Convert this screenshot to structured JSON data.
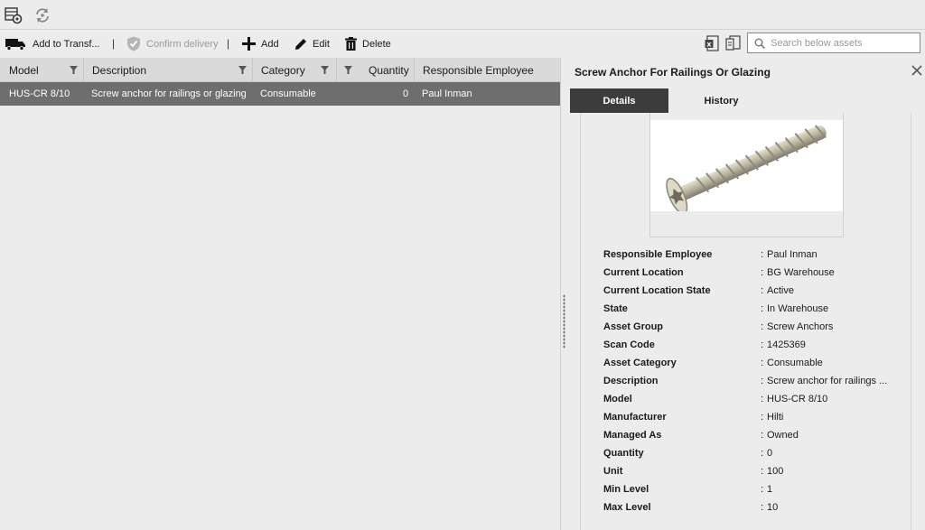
{
  "toolbar": {
    "add_to_transfer": "Add to Transf...",
    "confirm_delivery": "Confirm delivery",
    "separator": "|",
    "add": "Add",
    "edit": "Edit",
    "delete": "Delete"
  },
  "search": {
    "placeholder": "Search below assets"
  },
  "grid": {
    "columns": [
      "Model",
      "Description",
      "Category",
      "Quantity",
      "Responsible Employee"
    ],
    "rows": [
      {
        "model": "HUS-CR 8/10",
        "description": "Screw anchor for railings or glazing",
        "category": "Consumable",
        "quantity": "0",
        "responsible_employee": "Paul Inman"
      }
    ]
  },
  "panel": {
    "title": "Screw Anchor For Railings Or Glazing",
    "tabs": [
      "Details",
      "History"
    ],
    "colon": ":",
    "properties": [
      {
        "key": "Responsible Employee",
        "value": "Paul Inman"
      },
      {
        "key": "Current Location",
        "value": "BG Warehouse"
      },
      {
        "key": "Current Location State",
        "value": "Active"
      },
      {
        "key": "State",
        "value": "In Warehouse"
      },
      {
        "key": "Asset Group",
        "value": "Screw Anchors"
      },
      {
        "key": "Scan Code",
        "value": "1425369"
      },
      {
        "key": "Asset Category",
        "value": "Consumable"
      },
      {
        "key": "Description",
        "value": "Screw anchor for railings ..."
      },
      {
        "key": "Model",
        "value": "HUS-CR 8/10"
      },
      {
        "key": "Manufacturer",
        "value": "Hilti"
      },
      {
        "key": "Managed As",
        "value": "Owned"
      },
      {
        "key": "Quantity",
        "value": "0"
      },
      {
        "key": "Unit",
        "value": "100"
      },
      {
        "key": "Min Level",
        "value": "1"
      },
      {
        "key": "Max Level",
        "value": "10"
      }
    ]
  },
  "icons": {
    "top": [
      "asset-settings-icon",
      "refresh-icon"
    ],
    "toolbar": [
      "truck-transfer-icon",
      "shield-check-icon",
      "plus-icon",
      "pencil-icon",
      "trash-icon",
      "excel-export-icon",
      "layout-icon",
      "search-icon",
      "filter-icon",
      "close-icon"
    ]
  },
  "colors": {
    "selected_row": "#6e6e6e",
    "active_tab": "#3c3c3c",
    "header_bg": "#dadada"
  }
}
